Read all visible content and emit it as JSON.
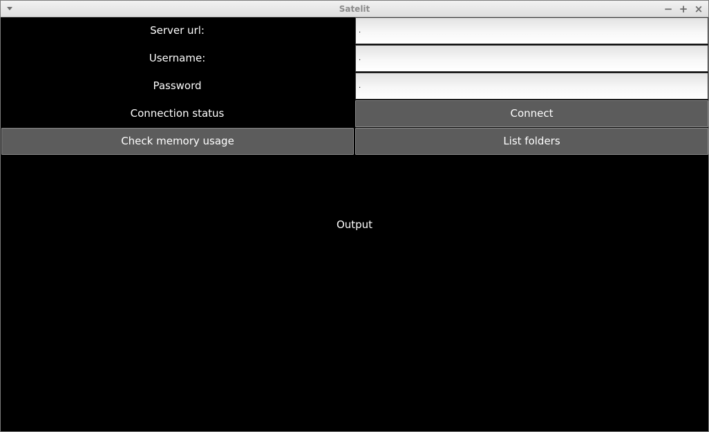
{
  "window": {
    "title": "Satelit",
    "controls": {
      "minimize": "−",
      "maximize": "+",
      "close": "×"
    }
  },
  "form": {
    "server_url_label": "Server url:",
    "server_url_value": ".",
    "username_label": "Username:",
    "username_value": ".",
    "password_label": "Password",
    "password_value": ".",
    "connection_status": "Connection status"
  },
  "buttons": {
    "connect": "Connect",
    "check_memory": "Check memory usage",
    "list_folders": "List folders"
  },
  "output": {
    "text": "Output"
  },
  "colors": {
    "background": "#000000",
    "button": "#5c5c5c",
    "titlebar": "#e6e6e6"
  }
}
